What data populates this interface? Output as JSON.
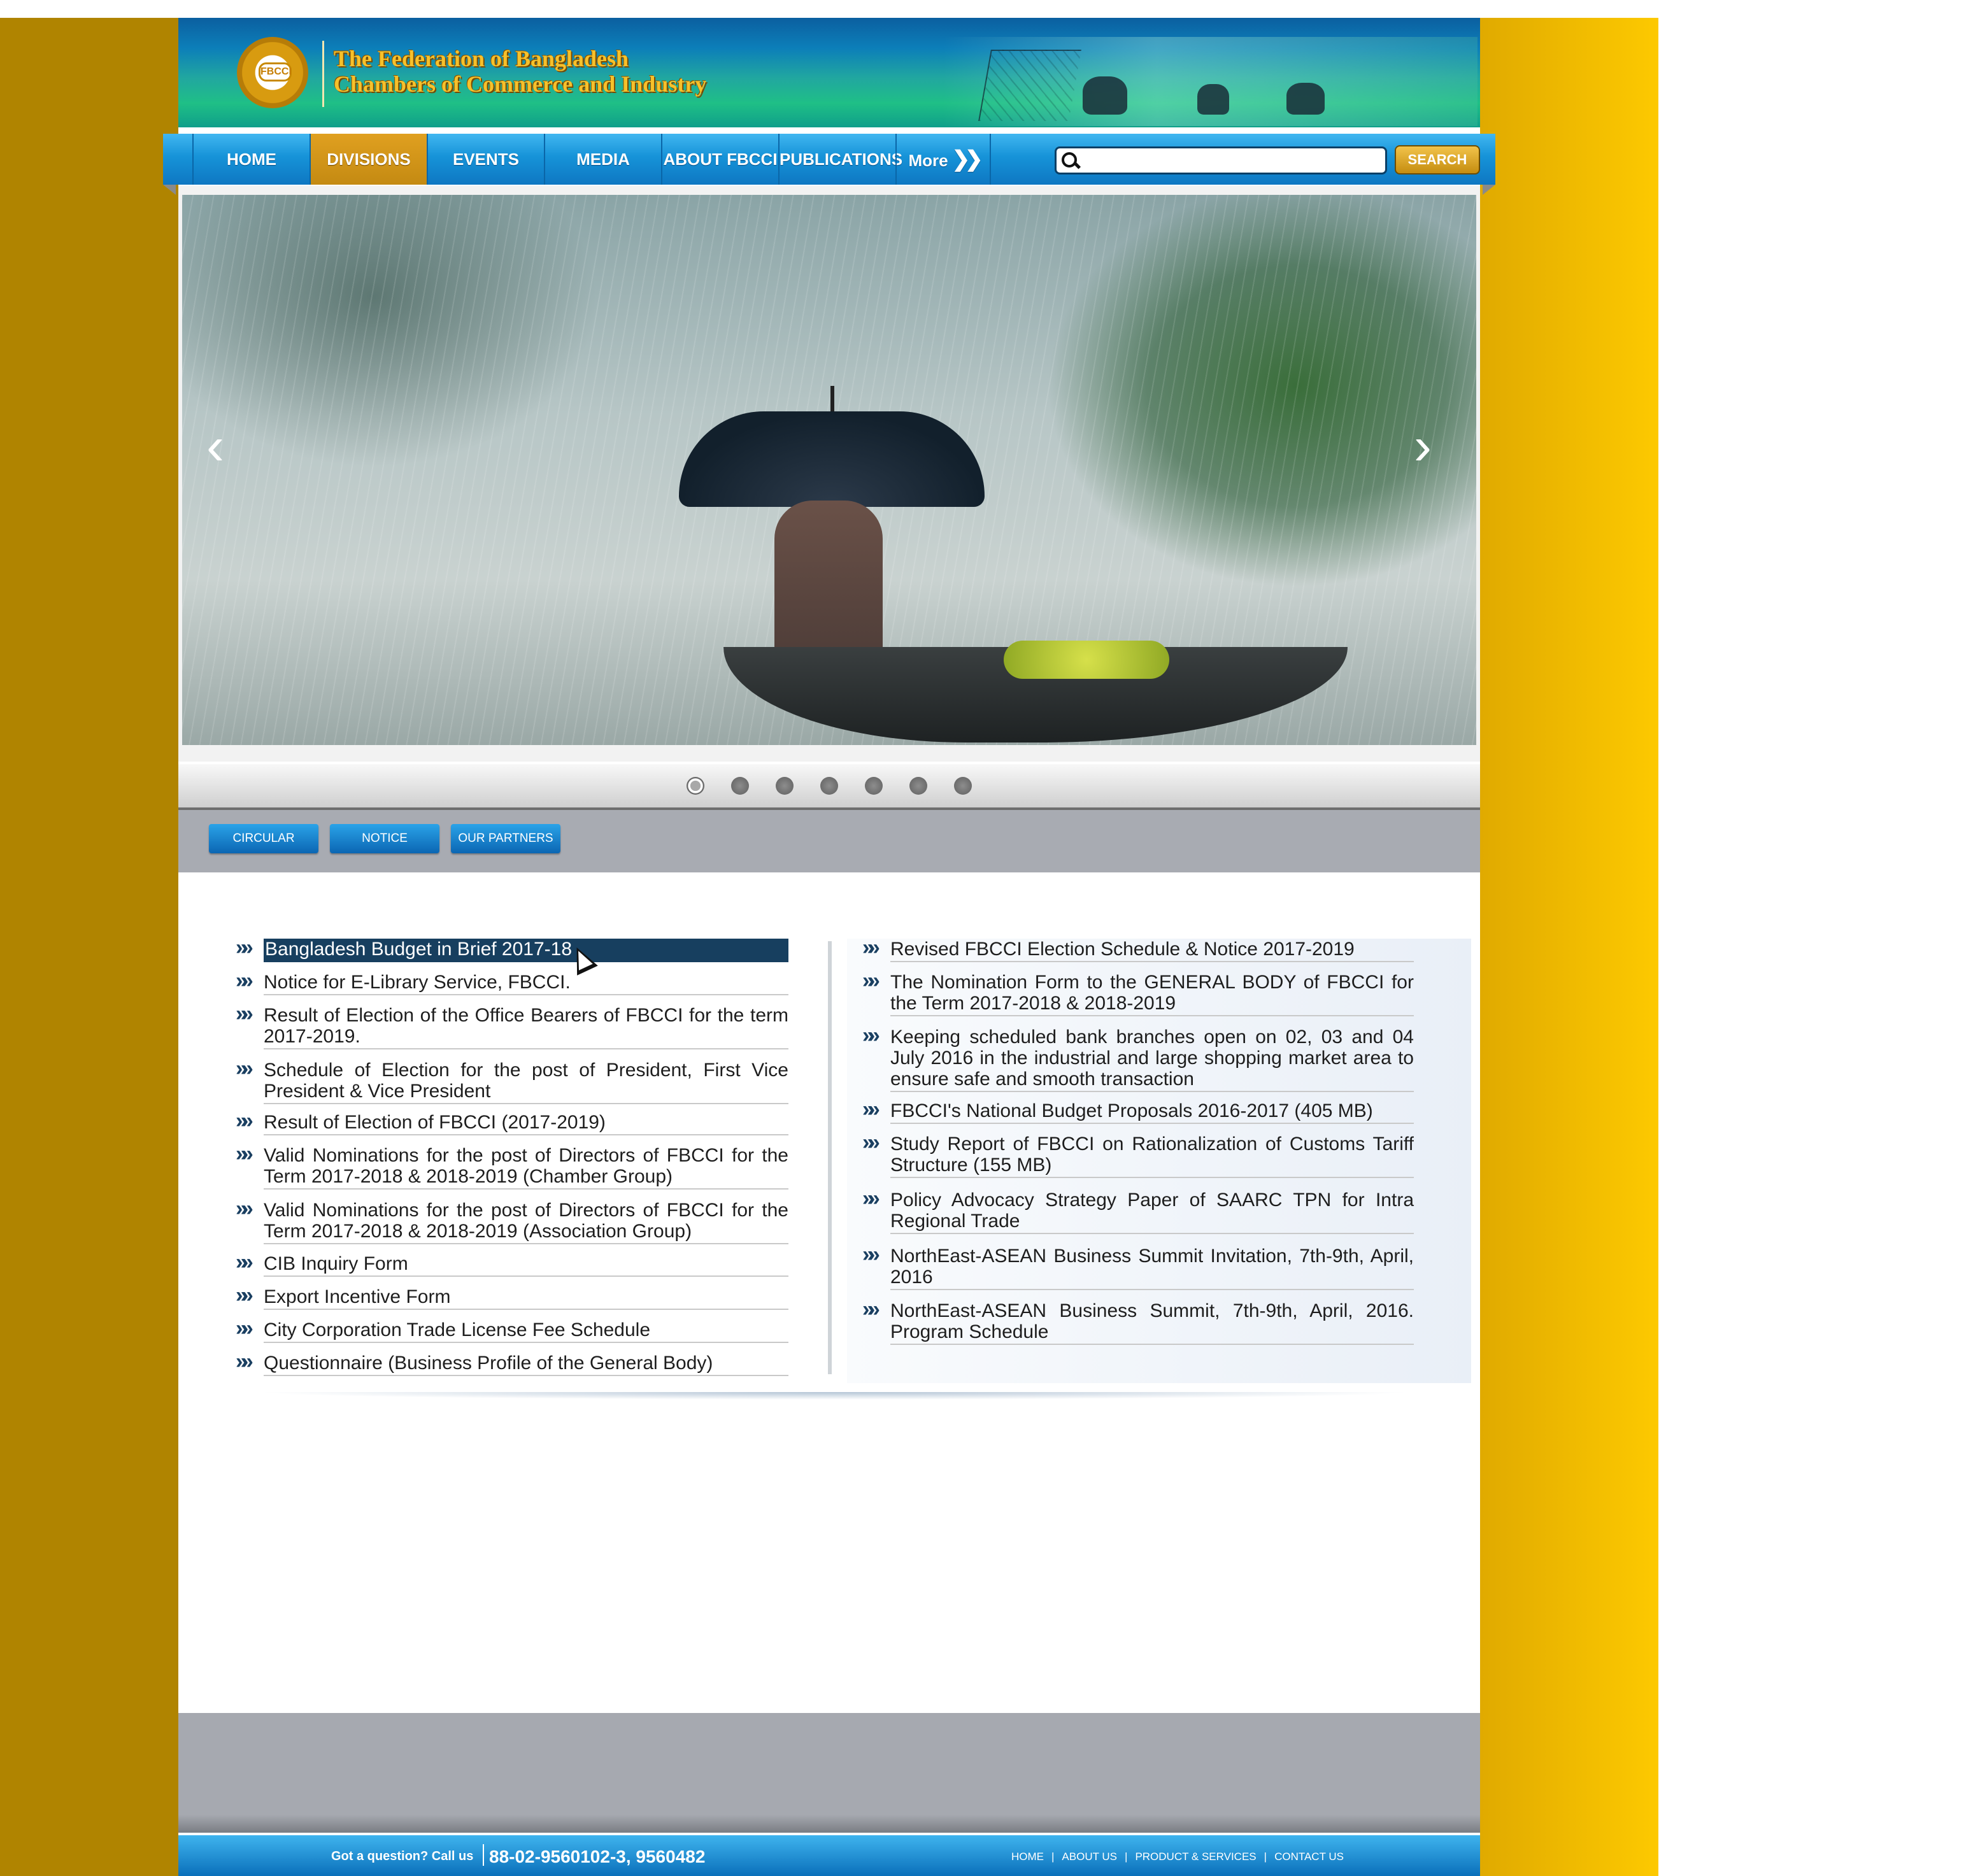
{
  "header": {
    "logo_badge_text": "FBCCI",
    "org_name_line1": "The Federation of Bangladesh",
    "org_name_line2": "Chambers of Commerce and Industry"
  },
  "nav": {
    "items": [
      {
        "label": "HOME"
      },
      {
        "label": "DIVISIONS",
        "active": true
      },
      {
        "label": "EVENTS"
      },
      {
        "label": "MEDIA"
      },
      {
        "label": "ABOUT FBCCI"
      },
      {
        "label": "PUBLICATIONS"
      },
      {
        "label": "More"
      }
    ],
    "more_icon": "double-chevron-right-icon"
  },
  "search": {
    "value": "",
    "button_label": "SEARCH"
  },
  "slider": {
    "prev_icon": "chevron-left-icon",
    "next_icon": "chevron-right-icon",
    "slide_count": 7,
    "active_index": 0
  },
  "tabs": [
    {
      "label": "CIRCULAR"
    },
    {
      "label": "NOTICE"
    },
    {
      "label": "OUR PARTNERS"
    }
  ],
  "news": {
    "left": [
      "Bangladesh Budget in Brief 2017-18",
      "Notice for E-Library Service, FBCCI.",
      "Result of Election of the Office Bearers of FBCCI for the term 2017-2019.",
      "Schedule of Election for the post of President, First Vice President & Vice President",
      "Result of Election of FBCCI (2017-2019)",
      "Valid Nominations for the post of Directors of FBCCI for the Term 2017-2018 & 2018-2019 (Chamber Group)",
      "Valid Nominations for the post of Directors of FBCCI for the Term 2017-2018 & 2018-2019 (Association Group)",
      "CIB Inquiry Form",
      "Export Incentive Form",
      "City Corporation Trade License Fee Schedule",
      "Questionnaire (Business Profile of the General Body)"
    ],
    "right": [
      "Revised FBCCI Election Schedule & Notice 2017-2019",
      "The Nomination Form to the GENERAL BODY of FBCCI for the Term 2017-2018 & 2018-2019",
      "Keeping scheduled bank branches open on 02, 03 and 04 July 2016 in the industrial and large shopping market area to ensure safe and smooth transaction",
      "FBCCI's National Budget Proposals 2016-2017 (405 MB)",
      "Study Report of FBCCI on Rationalization of Customs Tariff Structure (155 MB)",
      "Policy Advocacy Strategy Paper of SAARC TPN for Intra Regional Trade",
      "NorthEast-ASEAN Business Summit Invitation, 7th-9th, April, 2016",
      "NorthEast-ASEAN Business Summit, 7th-9th, April, 2016. Program Schedule"
    ],
    "bullet_icon": "double-chevron-right-icon"
  },
  "footer": {
    "question_text": "Got a question? Call us",
    "phone": "88-02-9560102-3, 9560482",
    "links": [
      "HOME",
      "ABOUT US",
      "PRODUCT & SERVICES",
      "CONTACT US"
    ],
    "separator": "|"
  },
  "colors": {
    "accent_gold": "#c48a12",
    "nav_blue": "#1693d8",
    "highlight_navy": "#173f5f",
    "side_gold_dark": "#b08400",
    "side_gold_light": "#fdc900"
  }
}
